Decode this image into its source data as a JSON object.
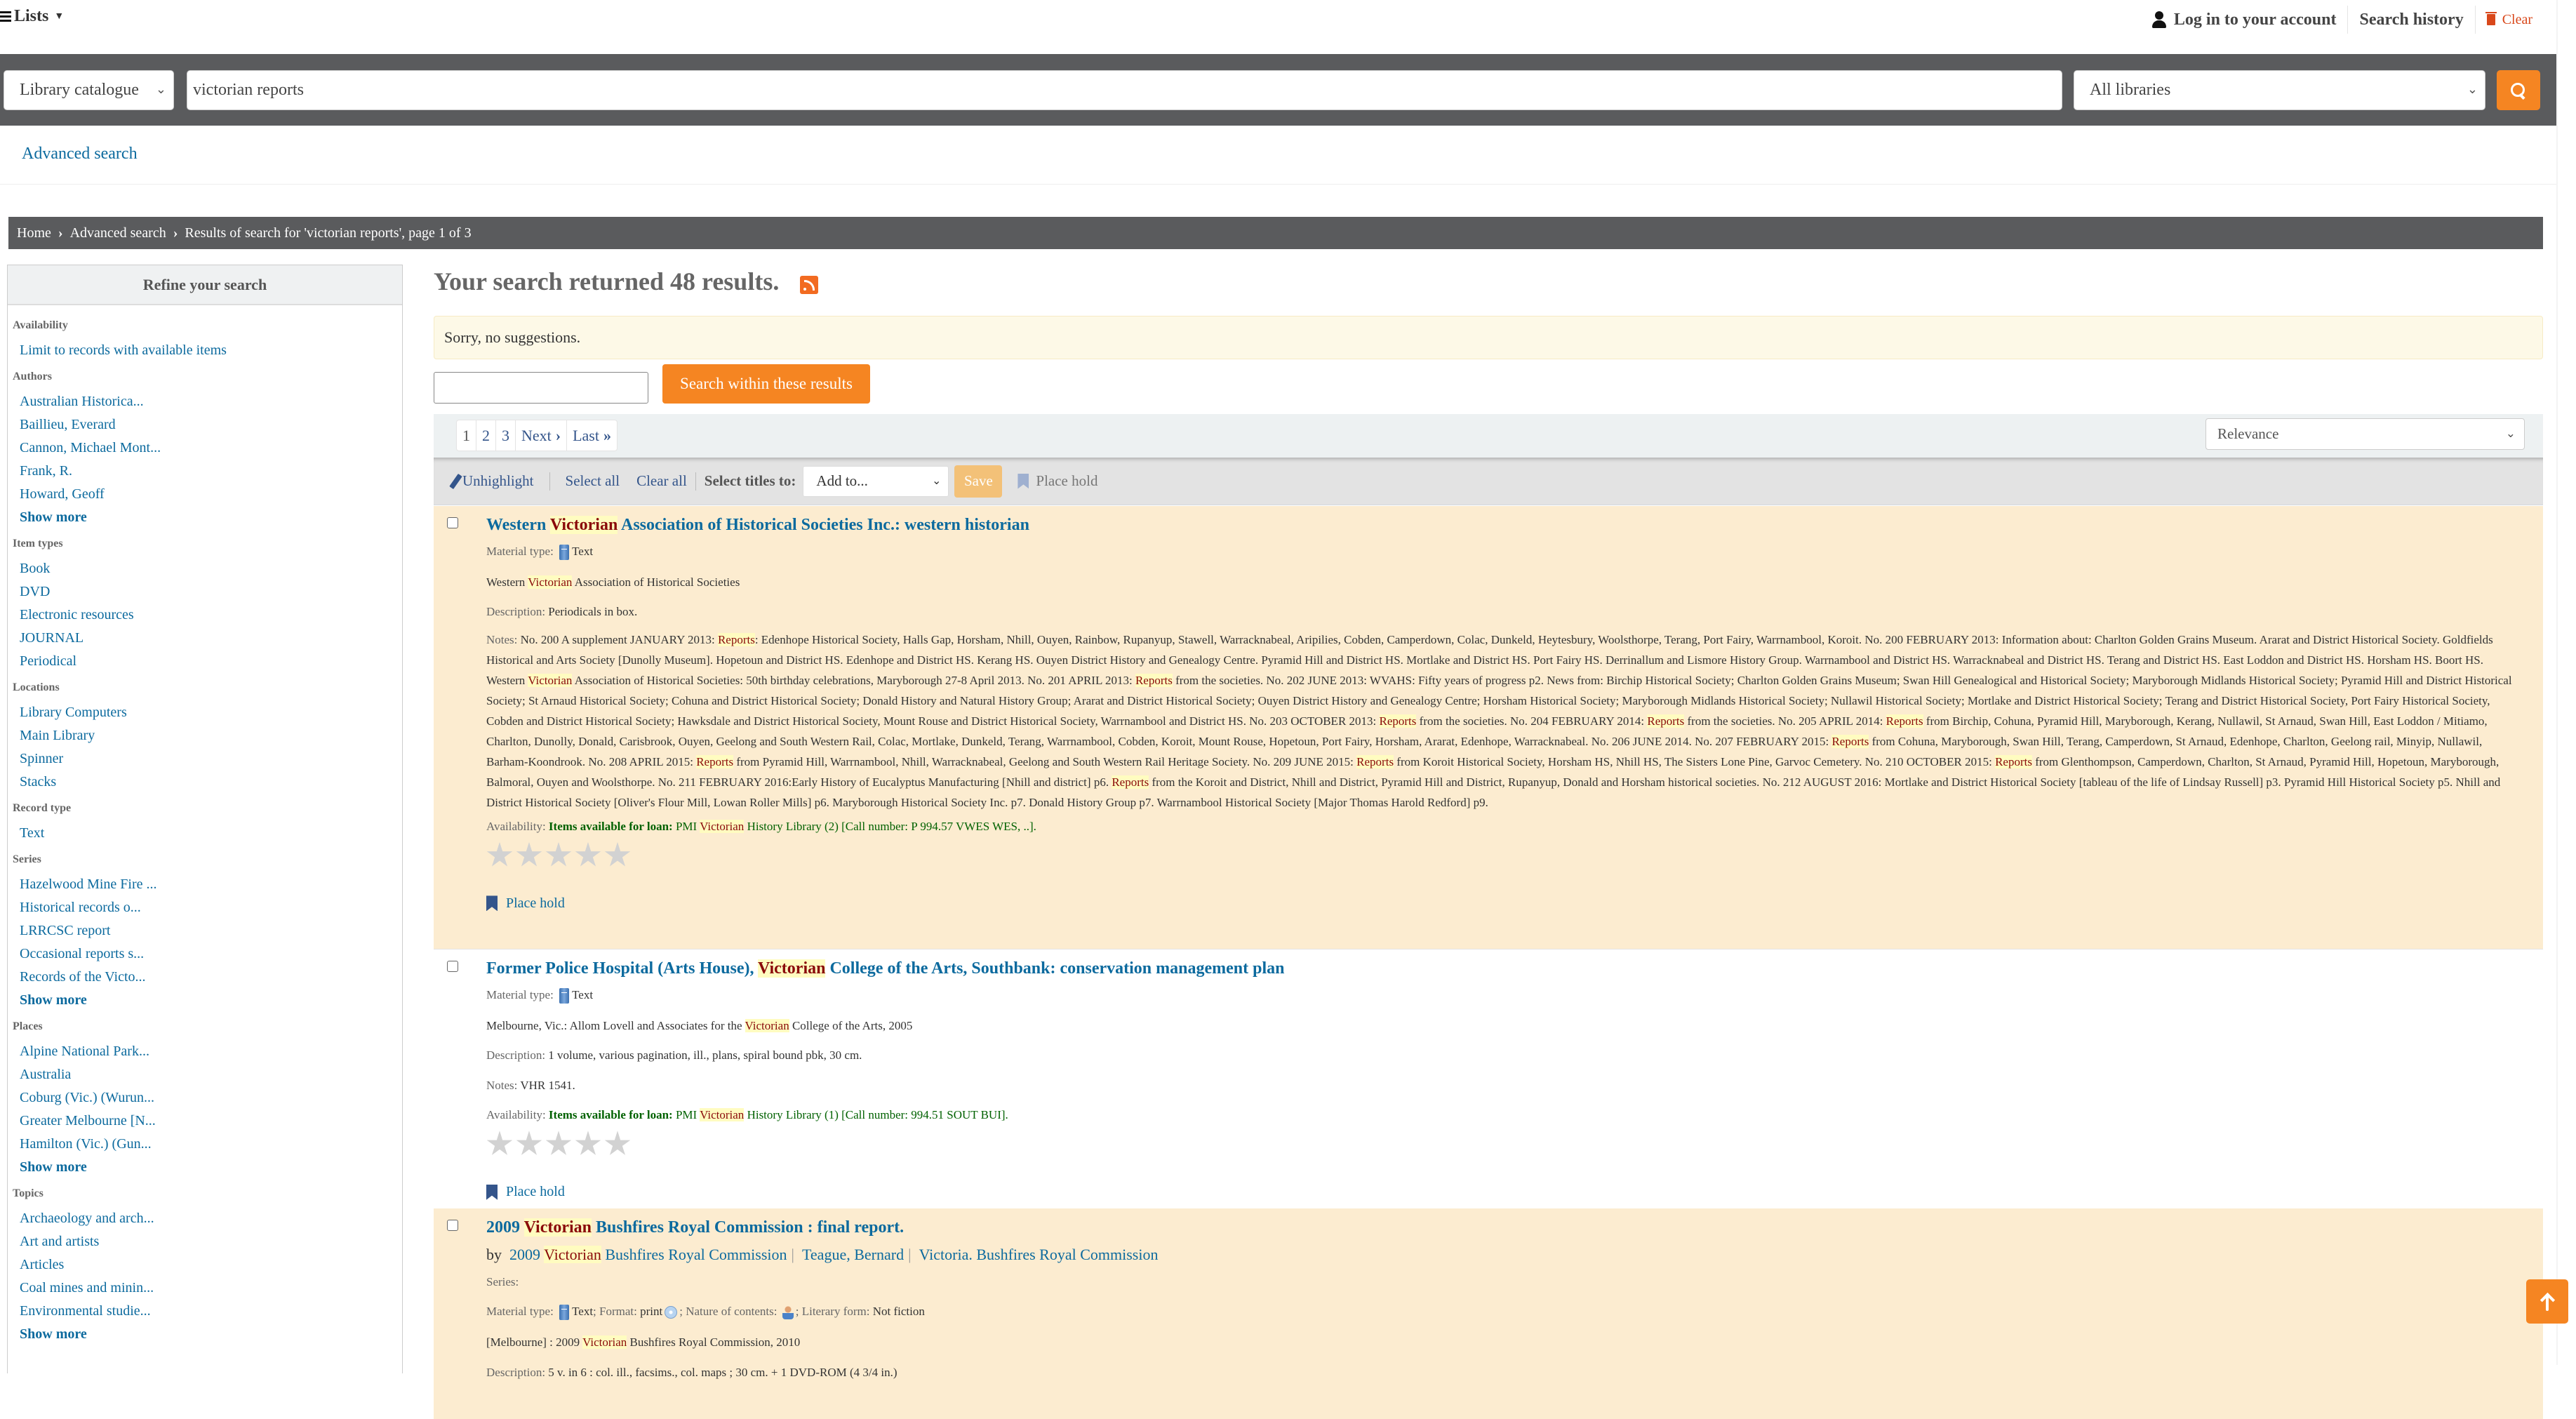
{
  "topbar": {
    "lists_label": "Lists",
    "login_label": "Log in to your account",
    "search_history_label": "Search history",
    "clear_label": "Clear"
  },
  "search": {
    "catalogue_select": "Library catalogue",
    "query_value": "victorian reports",
    "library_select": "All libraries",
    "submit_icon": "search-icon"
  },
  "advanced_search_label": "Advanced search",
  "breadcrumb": {
    "items": [
      "Home",
      "Advanced search",
      "Results of search for 'victorian reports', page 1 of 3"
    ]
  },
  "sidebar": {
    "title": "Refine your search",
    "facets": [
      {
        "title": "Availability",
        "items": [
          "Limit to records with available items"
        ],
        "show_more": null
      },
      {
        "title": "Authors",
        "items": [
          "Australian Historica...",
          "Baillieu, Everard",
          "Cannon, Michael Mont...",
          "Frank, R.",
          "Howard, Geoff"
        ],
        "show_more": "Show more"
      },
      {
        "title": "Item types",
        "items": [
          "Book",
          "DVD",
          "Electronic resources",
          "JOURNAL",
          "Periodical"
        ],
        "show_more": null
      },
      {
        "title": "Locations",
        "items": [
          "Library Computers",
          "Main Library",
          "Spinner",
          "Stacks"
        ],
        "show_more": null
      },
      {
        "title": "Record type",
        "items": [
          "Text"
        ],
        "show_more": null
      },
      {
        "title": "Series",
        "items": [
          "Hazelwood Mine Fire ...",
          "Historical records o...",
          "LRRCSC report",
          "Occasional reports s...",
          "Records of the Victo..."
        ],
        "show_more": "Show more"
      },
      {
        "title": "Places",
        "items": [
          "Alpine National Park...",
          "Australia",
          "Coburg (Vic.) (Wurun...",
          "Greater Melbourne [N...",
          "Hamilton (Vic.) (Gun..."
        ],
        "show_more": "Show more"
      },
      {
        "title": "Topics",
        "items": [
          "Archaeology and arch...",
          "Art and artists",
          "Articles",
          "Coal mines and minin...",
          "Environmental studie..."
        ],
        "show_more": "Show more"
      }
    ]
  },
  "main": {
    "results_heading": "Your search returned 48 results.",
    "suggestions": "Sorry, no suggestions.",
    "within_input_value": "",
    "within_button": "Search within these results",
    "pagination": {
      "pages": [
        "1",
        "2",
        "3"
      ],
      "next": "Next",
      "last": "Last"
    },
    "sort": "Relevance",
    "toolbar": {
      "unhighlight": "Unhighlight",
      "select_all": "Select all",
      "clear_all": "Clear all",
      "select_titles_label": "Select titles to:",
      "add_to": "Add to...",
      "save": "Save",
      "place_hold": "Place hold"
    },
    "results": [
      {
        "title_pre": "Western ",
        "title_hl": "Victorian",
        "title_post": " Association of Historical Societies Inc.: western historian",
        "material_label": "Material type:",
        "material_value": "Text",
        "author_pre": "Western ",
        "author_hl": "Victorian",
        "author_post": " Association of Historical Societies",
        "description_label": "Description:",
        "description_value": "Periodicals in box.",
        "notes_label": "Notes:",
        "notes_parts": [
          " No. 200 A supplement JANUARY 2013: ",
          {
            "hl": "Reports"
          },
          ": Edenhope Historical Society, Halls Gap, Horsham, Nhill, Ouyen, Rainbow, Rupanyup, Stawell, Warracknabeal, Aripilies, Cobden, Camperdown, Colac, Dunkeld, Heytesbury, Woolsthorpe, Terang, Port Fairy, Warrnambool, Koroit. No. 200 FEBRUARY 2013: Information about: Charlton Golden Grains Museum. Ararat and District Historical Society. Goldfields Historical and Arts Society [Dunolly Museum]. Hopetoun and District HS. Edenhope and District HS. Kerang HS. Ouyen District History and Genealogy Centre. Pyramid Hill and District HS. Mortlake and District HS. Port Fairy HS. Derrinallum and Lismore History Group. Warrnambool and District HS. Warracknabeal and District HS. Terang and District HS. East Loddon and District HS. Horsham HS. Boort HS. Western ",
          {
            "hl": "Victorian"
          },
          " Association of Historical Societies: 50th birthday celebrations, Maryborough 27-8 April 2013. No. 201 APRIL 2013: ",
          {
            "hl": "Reports"
          },
          " from the societies. No. 202 JUNE 2013: WVAHS: Fifty years of progress p2. News from: Birchip Historical Society; Charlton Golden Grains Museum; Swan Hill Genealogical and Historical Society; Maryborough Midlands Historical Society; Pyramid Hill and District Historical Society; St Arnaud Historical Society; Cohuna and District Historical Society; Donald History and Natural History Group; Ararat and District Historical Society; Ouyen District History and Genealogy Centre; Horsham Historical Society; Maryborough Midlands Historical Society; Nullawil Historical Society; Mortlake and District Historical Society; Terang and District Historical Society, Port Fairy Historical Society, Cobden and District Historical Society; Hawksdale and District Historical Society, Mount Rouse and District Historical Society, Warrnambool and District HS. No. 203 OCTOBER 2013: ",
          {
            "hl": "Reports"
          },
          " from the societies. No. 204 FEBRUARY 2014: ",
          {
            "hl": "Reports"
          },
          " from the societies. No. 205 APRIL 2014: ",
          {
            "hl": "Reports"
          },
          " from Birchip, Cohuna, Pyramid Hill, Maryborough, Kerang, Nullawil, St Arnaud, Swan Hill, East Loddon / Mitiamo, Charlton, Dunolly, Donald, Carisbrook, Ouyen, Geelong and South Western Rail, Colac, Mortlake, Dunkeld, Terang, Warrnambool, Cobden, Koroit, Mount Rouse, Hopetoun, Port Fairy, Horsham, Ararat, Edenhope, Warracknabeal. No. 206 JUNE 2014. No. 207 FEBRUARY 2015: ",
          {
            "hl": "Reports"
          },
          " from Cohuna, Maryborough, Swan Hill, Terang, Camperdown, St Arnaud, Edenhope, Charlton, Geelong rail, Minyip, Nullawil, Barham-Koondrook. No. 208 APRIL 2015: ",
          {
            "hl": "Reports"
          },
          " from Pyramid Hill, Warrnambool, Nhill, Warracknabeal, Geelong and South Western Rail Heritage Society. No. 209 JUNE 2015: ",
          {
            "hl": "Reports"
          },
          " from Koroit Historical Society, Horsham HS, Nhill HS, The Sisters Lone Pine, Garvoc Cemetery. No. 210 OCTOBER 2015: ",
          {
            "hl": "Reports"
          },
          " from Glenthompson, Camperdown, Charlton, St Arnaud, Pyramid Hill, Hopetoun, Maryborough, Balmoral, Ouyen and Woolsthorpe. No. 211 FEBRUARY 2016:Early History of Eucalyptus Manufacturing [Nhill and district] p6. ",
          {
            "hl": "Reports"
          },
          " from the Koroit and District, Nhill and District, Pyramid Hill and District, Rupanyup, Donald and Horsham historical societies. No. 212 AUGUST 2016: Mortlake and District Historical Society [tableau of the life of Lindsay Russell] p3. Pyramid Hill Historical Society p5. Nhill and District Historical Society [Oliver's Flour Mill, Lowan Roller Mills] p6. Maryborough Historical Society Inc. p7. Donald History Group p7. Warrnambool Historical Society [Major Thomas Harold Redford] p9."
        ],
        "availability_label": "Availability:",
        "availability_status": "Items available for loan:",
        "availability_pre": " PMI ",
        "availability_hl": "Victorian",
        "availability_post": " History Library (2) [Call number: P 994.57 VWES WES, ..].",
        "rating": 0,
        "rating_max": 5,
        "place_hold": "Place hold"
      },
      {
        "title_pre": "Former Police Hospital (Arts House), ",
        "title_hl": "Victorian",
        "title_post": " College of the Arts, Southbank: conservation management plan",
        "material_label": "Material type:",
        "material_value": "Text",
        "publisher_pre": "Melbourne, Vic.: Allom Lovell and Associates for the ",
        "publisher_hl": "Victorian",
        "publisher_post": " College of the Arts, 2005",
        "description_label": "Description:",
        "description_value": "1 volume, various pagination, ill., plans, spiral bound pbk, 30 cm.",
        "notes_label": "Notes:",
        "notes_value": "VHR 1541.",
        "availability_label": "Availability:",
        "availability_status": "Items available for loan:",
        "availability_pre": " PMI ",
        "availability_hl": "Victorian",
        "availability_post": " History Library (1) [Call number: 994.51 SOUT BUI].",
        "rating": 0,
        "rating_max": 5,
        "place_hold": "Place hold"
      },
      {
        "title_pre": "2009 ",
        "title_hl": "Victorian",
        "title_post": " Bushfires Royal Commission : final report.",
        "by_label": "by",
        "authors": [
          {
            "pre": "2009 ",
            "hl": "Victorian",
            "post": " Bushfires Royal Commission"
          },
          {
            "pre": "Teague, Bernard",
            "hl": "",
            "post": ""
          },
          {
            "pre": "Victoria. Bushfires Royal Commission",
            "hl": "",
            "post": ""
          }
        ],
        "series_label": "Series:",
        "material_label": "Material type:",
        "material_value": "Text",
        "format_label": "; Format:",
        "format_value": "print",
        "nature_label": "; Nature of contents:",
        "literary_label": "; Literary form:",
        "literary_value": "Not fiction",
        "publisher_pre": "[Melbourne] : 2009 ",
        "publisher_hl": "Victorian",
        "publisher_post": " Bushfires Royal Commission, 2010",
        "description_label": "Description:",
        "description_value": "5 v. in 6 : col. ill., facsims., col. maps ; 30 cm. + 1 DVD-ROM (4 3/4 in.)"
      }
    ]
  },
  "colors": {
    "accent_orange": "#f58522",
    "link_blue": "#0c6a9e",
    "band_gray": "#5a5b5d",
    "highlight_bg": "#fffcc0",
    "highlight_text": "#8a0a0a",
    "odd_row_bg": "#fcecd0",
    "available_green": "#006100"
  }
}
